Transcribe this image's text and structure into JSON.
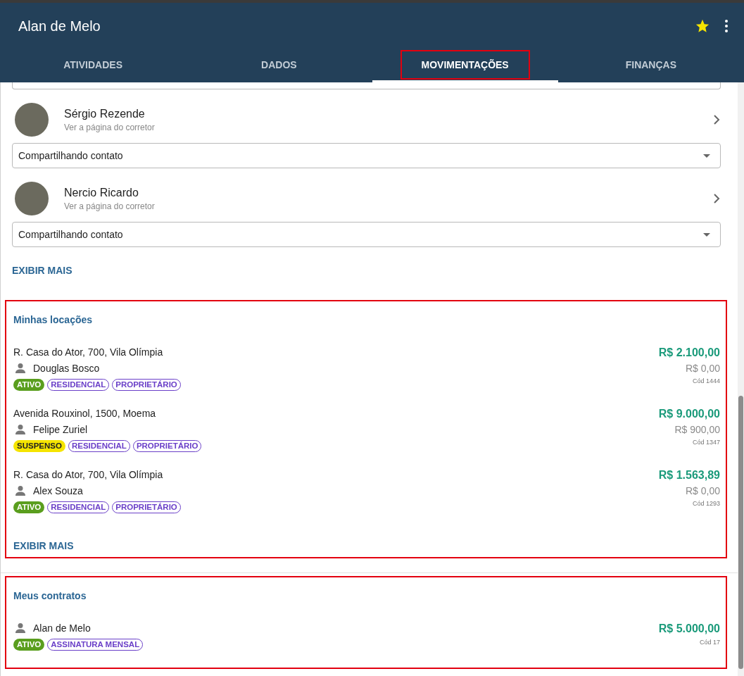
{
  "header": {
    "title": "Alan de Melo",
    "favorite": true
  },
  "tabs": [
    {
      "label": "ATIVIDADES",
      "selected": false,
      "highlighted": false
    },
    {
      "label": "DADOS",
      "selected": false,
      "highlighted": false
    },
    {
      "label": "MOVIMENTAÇÕES",
      "selected": true,
      "highlighted": true
    },
    {
      "label": "FINANÇAS",
      "selected": false,
      "highlighted": false
    }
  ],
  "brokers": [
    {
      "name": "Sérgio Rezende",
      "link": "Ver a página do corretor",
      "share": "Compartilhando contato"
    },
    {
      "name": "Nercio Ricardo",
      "link": "Ver a página do corretor",
      "share": "Compartilhando contato"
    }
  ],
  "brokers_more": "EXIBIR MAIS",
  "sections": [
    {
      "title": "Minhas locações",
      "highlighted": true,
      "more": "EXIBIR MAIS",
      "items": [
        {
          "address": "R. Casa do Ator, 700, Vila Olímpia",
          "person": "Douglas Bosco",
          "amount": "R$ 2.100,00",
          "secondary": "R$ 0,00",
          "code": "Cód 1444",
          "tags": [
            {
              "text": "ATIVO",
              "kind": "filled",
              "color": "#5a9e1e"
            },
            {
              "text": "RESIDENCIAL",
              "kind": "outline",
              "color": "#6a3fc8"
            },
            {
              "text": "PROPRIETÁRIO",
              "kind": "outline",
              "color": "#6a3fc8"
            }
          ]
        },
        {
          "address": "Avenida Rouxinol, 1500, Moema",
          "person": "Felipe Zuriel",
          "amount": "R$ 9.000,00",
          "secondary": "R$ 900,00",
          "code": "Cód 1347",
          "tags": [
            {
              "text": "SUSPENSO",
              "kind": "filled",
              "color": "#f5e400"
            },
            {
              "text": "RESIDENCIAL",
              "kind": "outline",
              "color": "#6a3fc8"
            },
            {
              "text": "PROPRIETÁRIO",
              "kind": "outline",
              "color": "#6a3fc8"
            }
          ]
        },
        {
          "address": "R. Casa do Ator, 700, Vila Olímpia",
          "person": "Alex Souza",
          "amount": "R$ 1.563,89",
          "secondary": "R$ 0,00",
          "code": "Cód 1293",
          "tags": [
            {
              "text": "ATIVO",
              "kind": "filled",
              "color": "#5a9e1e"
            },
            {
              "text": "RESIDENCIAL",
              "kind": "outline",
              "color": "#6a3fc8"
            },
            {
              "text": "PROPRIETÁRIO",
              "kind": "outline",
              "color": "#6a3fc8"
            }
          ]
        }
      ]
    },
    {
      "title": "Meus contratos",
      "highlighted": true,
      "items": [
        {
          "person": "Alan de Melo",
          "amount": "R$ 5.000,00",
          "code": "Cód 17",
          "tags": [
            {
              "text": "ATIVO",
              "kind": "filled",
              "color": "#5a9e1e"
            },
            {
              "text": "ASSINATURA MENSAL",
              "kind": "outline",
              "color": "#6a3fc8"
            }
          ]
        }
      ]
    }
  ]
}
